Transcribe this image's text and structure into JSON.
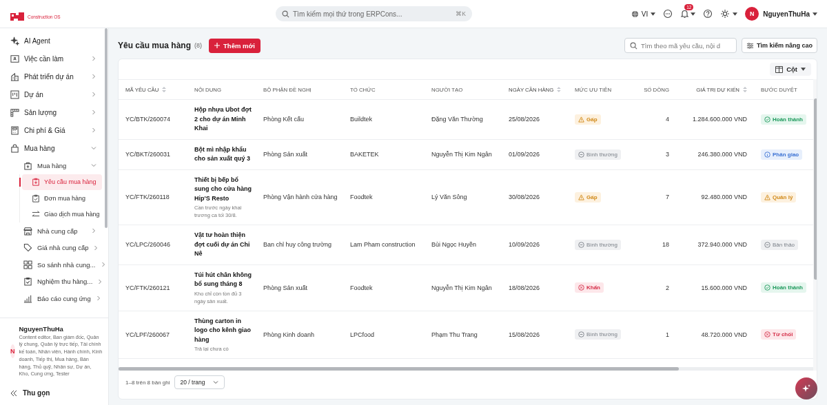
{
  "brand": {
    "tagline": "Construction OS"
  },
  "topbar": {
    "search": {
      "placeholder": "Tìm kiếm mọi thứ trong ERPCons...",
      "shortcut": "⌘K"
    },
    "language": "VI",
    "notifications": "12",
    "user": {
      "initial": "N",
      "name": "NguyenThuHa"
    }
  },
  "sidebar": {
    "items": [
      {
        "label": "AI Agent",
        "selected": false
      },
      {
        "label": "Việc cần làm",
        "selected": false,
        "expanded": false
      },
      {
        "label": "Phát triển dự án",
        "selected": false,
        "expanded": false
      },
      {
        "label": "Dự án",
        "selected": false,
        "expanded": false
      },
      {
        "label": "Sản lượng",
        "selected": false,
        "expanded": false
      },
      {
        "label": "Chi phí & Giá",
        "selected": false,
        "expanded": false
      },
      {
        "label": "Mua hàng",
        "selected": false,
        "expanded": true,
        "children": [
          {
            "label": "Mua hàng",
            "selected": false,
            "expanded": true,
            "children": [
              {
                "label": "Yêu cầu mua hàng",
                "selected": true
              },
              {
                "label": "Đơn mua hàng",
                "selected": false
              },
              {
                "label": "Giao dịch mua hàng",
                "selected": false
              }
            ]
          },
          {
            "label": "Nhà cung cấp",
            "selected": false,
            "expanded": false
          },
          {
            "label": "Giá nhà cung cấp",
            "selected": false,
            "expanded": false
          },
          {
            "label": "So sánh nhà cung...",
            "selected": false,
            "expanded": false
          },
          {
            "label": "Nghiệm thu hàng...",
            "selected": false,
            "expanded": false
          },
          {
            "label": "Báo cáo cung ứng",
            "selected": false,
            "expanded": false
          }
        ]
      }
    ],
    "user": {
      "initial": "N",
      "name": "NguyenThuHa",
      "roles": "Content editor, Ban giám đốc, Quản lý chung, Quản lý trực tiếp, Tài chính kế toán, Nhân viên, Hành chính, Kinh doanh, Tiếp thị, Mua hàng, Bán hàng, Thủ quỹ, Nhân sự, Dự án, Kho, Cung ứng, Tester"
    },
    "collapse": "Thu gọn"
  },
  "page": {
    "title": "Yêu cầu mua hàng",
    "count": "(8)",
    "add_button": "Thêm mới",
    "search": {
      "placeholder": "Tìm theo mã yêu cầu, nội d"
    },
    "advanced_button": "Tìm kiếm nâng cao",
    "columns_button": "Cột"
  },
  "table": {
    "columns": [
      {
        "label": "MÃ YÊU CẦU",
        "sortable": true
      },
      {
        "label": "NỘI DUNG",
        "sortable": false
      },
      {
        "label": "BỘ PHẬN ĐỀ NGHỊ",
        "sortable": false
      },
      {
        "label": "TỔ CHỨC",
        "sortable": false
      },
      {
        "label": "NGƯỜI TẠO",
        "sortable": false
      },
      {
        "label": "NGÀY CẦN HÀNG",
        "sortable": true
      },
      {
        "label": "MỨC ƯU TIÊN",
        "sortable": false
      },
      {
        "label": "SỐ DÒNG",
        "sortable": false
      },
      {
        "label": "GIÁ TRỊ DỰ KIẾN",
        "sortable": true
      },
      {
        "label": "BƯỚC DUYỆT",
        "sortable": false
      }
    ],
    "rows": [
      {
        "code": "YC/BTK/260074",
        "content": "Hộp nhựa Ubot đợt 2 cho dự án Minh Khai",
        "department": "Phòng Kết cấu",
        "organization": "Buildtek",
        "creator": "Đặng Văn Thường",
        "date": "25/08/2026",
        "priority": {
          "text": "Gấp",
          "kind": "warning"
        },
        "lines": "4",
        "value": "1.284.600.000 VND",
        "step": {
          "text": "Hoàn thành",
          "kind": "success"
        }
      },
      {
        "code": "YC/BKT/260031",
        "content": "Bột mì nhập khẩu cho sản xuất quý 3",
        "department": "Phòng Sản xuất",
        "organization": "BAKETEK",
        "creator": "Nguyễn Thị Kim Ngân",
        "date": "01/09/2026",
        "priority": {
          "text": "Bình thường",
          "kind": "neutral"
        },
        "lines": "3",
        "value": "246.380.000 VND",
        "step": {
          "text": "Phân giao",
          "kind": "info"
        }
      },
      {
        "code": "YC/FTK/260118",
        "content": "Thiết bị bếp bổ sung cho cửa hàng Hip'S Resto",
        "note": "Cần trước ngày khai trương ca tối 30/8.",
        "department": "Phòng Vận hành cửa hàng",
        "organization": "Foodtek",
        "creator": "Lý Văn Sông",
        "date": "30/08/2026",
        "priority": {
          "text": "Gấp",
          "kind": "warning"
        },
        "lines": "7",
        "value": "92.480.000 VND",
        "step": {
          "text": "Quản lý",
          "kind": "warning"
        }
      },
      {
        "code": "YC/LPC/260046",
        "content": "Vật tư hoàn thiện đợt cuối dự án Chi Nê",
        "department": "Ban chỉ huy công trường",
        "organization": "Lam Pham construction",
        "creator": "Bùi Ngọc Huyền",
        "date": "10/09/2026",
        "priority": {
          "text": "Bình thường",
          "kind": "neutral"
        },
        "lines": "18",
        "value": "372.940.000 VND",
        "step": {
          "text": "Bản thảo",
          "kind": "neutral"
        }
      },
      {
        "code": "YC/FTK/260121",
        "content": "Túi hút chân không bổ sung tháng 8",
        "note": "Kho chỉ còn tồn đủ 3 ngày sản xuất.",
        "department": "Phòng Sản xuất",
        "organization": "Foodtek",
        "creator": "Nguyễn Thị Kim Ngân",
        "date": "18/08/2026",
        "priority": {
          "text": "Khẩn",
          "kind": "danger"
        },
        "lines": "2",
        "value": "15.600.000 VND",
        "step": {
          "text": "Hoàn thành",
          "kind": "success"
        }
      },
      {
        "code": "YC/LPF/260067",
        "content": "Thùng carton in logo cho kênh giao hàng",
        "note": "Trả lại chưa có",
        "department": "Phòng Kinh doanh",
        "organization": "LPCfood",
        "creator": "Phạm Thu Trang",
        "date": "15/08/2026",
        "priority": {
          "text": "Bình thường",
          "kind": "neutral"
        },
        "lines": "1",
        "value": "48.720.000 VND",
        "step": {
          "text": "Từ chối",
          "kind": "danger"
        }
      }
    ],
    "summary": "1–8 trên 8 bản ghi",
    "page_size": "20 / trang"
  }
}
